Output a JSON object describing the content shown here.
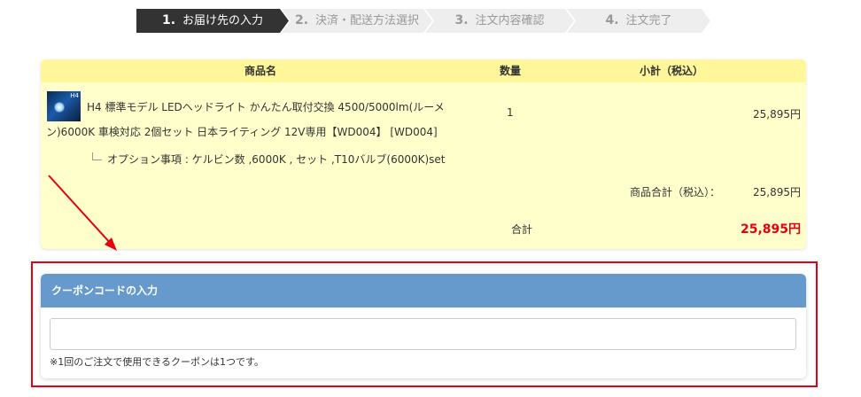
{
  "steps": [
    {
      "num": "1.",
      "label": "お届け先の入力",
      "active": true
    },
    {
      "num": "2.",
      "label": "決済・配送方法選択",
      "active": false
    },
    {
      "num": "3.",
      "label": "注文内容確認",
      "active": false
    },
    {
      "num": "4.",
      "label": "注文完了",
      "active": false
    }
  ],
  "cart": {
    "headers": {
      "name": "商品名",
      "qty": "数量",
      "subtotal": "小計（税込）"
    },
    "item": {
      "thumb_label": "H4",
      "name": "H4 標準モデル LEDヘッドライト かんたん取付交換 4500/5000lm(ルーメン)6000K 車検対応 2個セット 日本ライティング 12V専用【WD004】 [WD004]",
      "qty": "1",
      "price": "25,895円",
      "option": "オプション事項 : ケルビン数 ,6000K , セット ,T10バルブ(6000K)set"
    },
    "subtotal_label": "商品合計（税込）：",
    "subtotal_value": "25,895円",
    "total_label": "合計",
    "total_value": "25,895円"
  },
  "coupon": {
    "title": "クーポンコードの入力",
    "value": "",
    "note": "※1回のご注文で使用できるクーポンは1つです。"
  },
  "colors": {
    "accent_red": "#e60012",
    "coupon_header": "#6699cc",
    "cart_bg": "#ffffcc",
    "cart_header": "#fff799",
    "step_active": "#333333",
    "step_inactive": "#eeeeee"
  }
}
